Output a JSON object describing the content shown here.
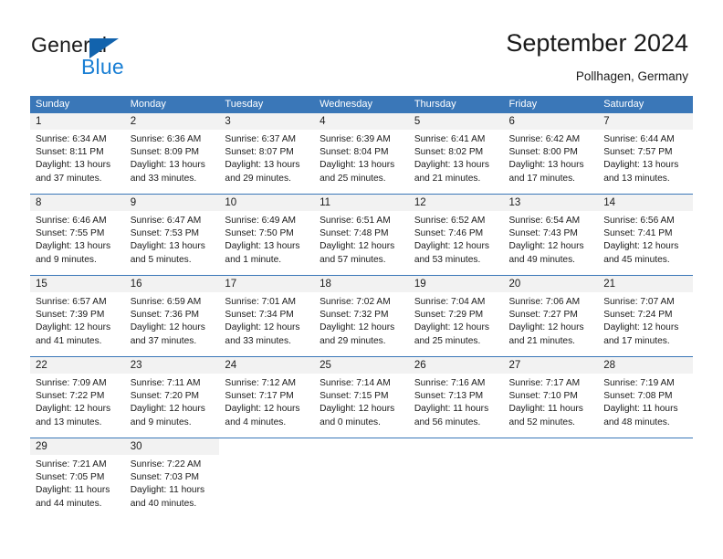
{
  "logo": {
    "text_primary": "General",
    "text_secondary": "Blue",
    "triangle_color": "#1263ad",
    "secondary_color": "#1a7fd4"
  },
  "header": {
    "title": "September 2024",
    "location": "Pollhagen, Germany"
  },
  "theme": {
    "header_bg": "#3a77b8",
    "header_text": "#ffffff",
    "daynum_bg": "#f2f2f2",
    "row_divider": "#3a77b8",
    "body_text": "#1a1a1a"
  },
  "calendar": {
    "weekday_headers": [
      "Sunday",
      "Monday",
      "Tuesday",
      "Wednesday",
      "Thursday",
      "Friday",
      "Saturday"
    ],
    "weeks": [
      [
        {
          "day": "1",
          "sunrise": "Sunrise: 6:34 AM",
          "sunset": "Sunset: 8:11 PM",
          "daylight1": "Daylight: 13 hours",
          "daylight2": "and 37 minutes."
        },
        {
          "day": "2",
          "sunrise": "Sunrise: 6:36 AM",
          "sunset": "Sunset: 8:09 PM",
          "daylight1": "Daylight: 13 hours",
          "daylight2": "and 33 minutes."
        },
        {
          "day": "3",
          "sunrise": "Sunrise: 6:37 AM",
          "sunset": "Sunset: 8:07 PM",
          "daylight1": "Daylight: 13 hours",
          "daylight2": "and 29 minutes."
        },
        {
          "day": "4",
          "sunrise": "Sunrise: 6:39 AM",
          "sunset": "Sunset: 8:04 PM",
          "daylight1": "Daylight: 13 hours",
          "daylight2": "and 25 minutes."
        },
        {
          "day": "5",
          "sunrise": "Sunrise: 6:41 AM",
          "sunset": "Sunset: 8:02 PM",
          "daylight1": "Daylight: 13 hours",
          "daylight2": "and 21 minutes."
        },
        {
          "day": "6",
          "sunrise": "Sunrise: 6:42 AM",
          "sunset": "Sunset: 8:00 PM",
          "daylight1": "Daylight: 13 hours",
          "daylight2": "and 17 minutes."
        },
        {
          "day": "7",
          "sunrise": "Sunrise: 6:44 AM",
          "sunset": "Sunset: 7:57 PM",
          "daylight1": "Daylight: 13 hours",
          "daylight2": "and 13 minutes."
        }
      ],
      [
        {
          "day": "8",
          "sunrise": "Sunrise: 6:46 AM",
          "sunset": "Sunset: 7:55 PM",
          "daylight1": "Daylight: 13 hours",
          "daylight2": "and 9 minutes."
        },
        {
          "day": "9",
          "sunrise": "Sunrise: 6:47 AM",
          "sunset": "Sunset: 7:53 PM",
          "daylight1": "Daylight: 13 hours",
          "daylight2": "and 5 minutes."
        },
        {
          "day": "10",
          "sunrise": "Sunrise: 6:49 AM",
          "sunset": "Sunset: 7:50 PM",
          "daylight1": "Daylight: 13 hours",
          "daylight2": "and 1 minute."
        },
        {
          "day": "11",
          "sunrise": "Sunrise: 6:51 AM",
          "sunset": "Sunset: 7:48 PM",
          "daylight1": "Daylight: 12 hours",
          "daylight2": "and 57 minutes."
        },
        {
          "day": "12",
          "sunrise": "Sunrise: 6:52 AM",
          "sunset": "Sunset: 7:46 PM",
          "daylight1": "Daylight: 12 hours",
          "daylight2": "and 53 minutes."
        },
        {
          "day": "13",
          "sunrise": "Sunrise: 6:54 AM",
          "sunset": "Sunset: 7:43 PM",
          "daylight1": "Daylight: 12 hours",
          "daylight2": "and 49 minutes."
        },
        {
          "day": "14",
          "sunrise": "Sunrise: 6:56 AM",
          "sunset": "Sunset: 7:41 PM",
          "daylight1": "Daylight: 12 hours",
          "daylight2": "and 45 minutes."
        }
      ],
      [
        {
          "day": "15",
          "sunrise": "Sunrise: 6:57 AM",
          "sunset": "Sunset: 7:39 PM",
          "daylight1": "Daylight: 12 hours",
          "daylight2": "and 41 minutes."
        },
        {
          "day": "16",
          "sunrise": "Sunrise: 6:59 AM",
          "sunset": "Sunset: 7:36 PM",
          "daylight1": "Daylight: 12 hours",
          "daylight2": "and 37 minutes."
        },
        {
          "day": "17",
          "sunrise": "Sunrise: 7:01 AM",
          "sunset": "Sunset: 7:34 PM",
          "daylight1": "Daylight: 12 hours",
          "daylight2": "and 33 minutes."
        },
        {
          "day": "18",
          "sunrise": "Sunrise: 7:02 AM",
          "sunset": "Sunset: 7:32 PM",
          "daylight1": "Daylight: 12 hours",
          "daylight2": "and 29 minutes."
        },
        {
          "day": "19",
          "sunrise": "Sunrise: 7:04 AM",
          "sunset": "Sunset: 7:29 PM",
          "daylight1": "Daylight: 12 hours",
          "daylight2": "and 25 minutes."
        },
        {
          "day": "20",
          "sunrise": "Sunrise: 7:06 AM",
          "sunset": "Sunset: 7:27 PM",
          "daylight1": "Daylight: 12 hours",
          "daylight2": "and 21 minutes."
        },
        {
          "day": "21",
          "sunrise": "Sunrise: 7:07 AM",
          "sunset": "Sunset: 7:24 PM",
          "daylight1": "Daylight: 12 hours",
          "daylight2": "and 17 minutes."
        }
      ],
      [
        {
          "day": "22",
          "sunrise": "Sunrise: 7:09 AM",
          "sunset": "Sunset: 7:22 PM",
          "daylight1": "Daylight: 12 hours",
          "daylight2": "and 13 minutes."
        },
        {
          "day": "23",
          "sunrise": "Sunrise: 7:11 AM",
          "sunset": "Sunset: 7:20 PM",
          "daylight1": "Daylight: 12 hours",
          "daylight2": "and 9 minutes."
        },
        {
          "day": "24",
          "sunrise": "Sunrise: 7:12 AM",
          "sunset": "Sunset: 7:17 PM",
          "daylight1": "Daylight: 12 hours",
          "daylight2": "and 4 minutes."
        },
        {
          "day": "25",
          "sunrise": "Sunrise: 7:14 AM",
          "sunset": "Sunset: 7:15 PM",
          "daylight1": "Daylight: 12 hours",
          "daylight2": "and 0 minutes."
        },
        {
          "day": "26",
          "sunrise": "Sunrise: 7:16 AM",
          "sunset": "Sunset: 7:13 PM",
          "daylight1": "Daylight: 11 hours",
          "daylight2": "and 56 minutes."
        },
        {
          "day": "27",
          "sunrise": "Sunrise: 7:17 AM",
          "sunset": "Sunset: 7:10 PM",
          "daylight1": "Daylight: 11 hours",
          "daylight2": "and 52 minutes."
        },
        {
          "day": "28",
          "sunrise": "Sunrise: 7:19 AM",
          "sunset": "Sunset: 7:08 PM",
          "daylight1": "Daylight: 11 hours",
          "daylight2": "and 48 minutes."
        }
      ],
      [
        {
          "day": "29",
          "sunrise": "Sunrise: 7:21 AM",
          "sunset": "Sunset: 7:05 PM",
          "daylight1": "Daylight: 11 hours",
          "daylight2": "and 44 minutes."
        },
        {
          "day": "30",
          "sunrise": "Sunrise: 7:22 AM",
          "sunset": "Sunset: 7:03 PM",
          "daylight1": "Daylight: 11 hours",
          "daylight2": "and 40 minutes."
        },
        {
          "day": "",
          "sunrise": "",
          "sunset": "",
          "daylight1": "",
          "daylight2": ""
        },
        {
          "day": "",
          "sunrise": "",
          "sunset": "",
          "daylight1": "",
          "daylight2": ""
        },
        {
          "day": "",
          "sunrise": "",
          "sunset": "",
          "daylight1": "",
          "daylight2": ""
        },
        {
          "day": "",
          "sunrise": "",
          "sunset": "",
          "daylight1": "",
          "daylight2": ""
        },
        {
          "day": "",
          "sunrise": "",
          "sunset": "",
          "daylight1": "",
          "daylight2": ""
        }
      ]
    ]
  }
}
